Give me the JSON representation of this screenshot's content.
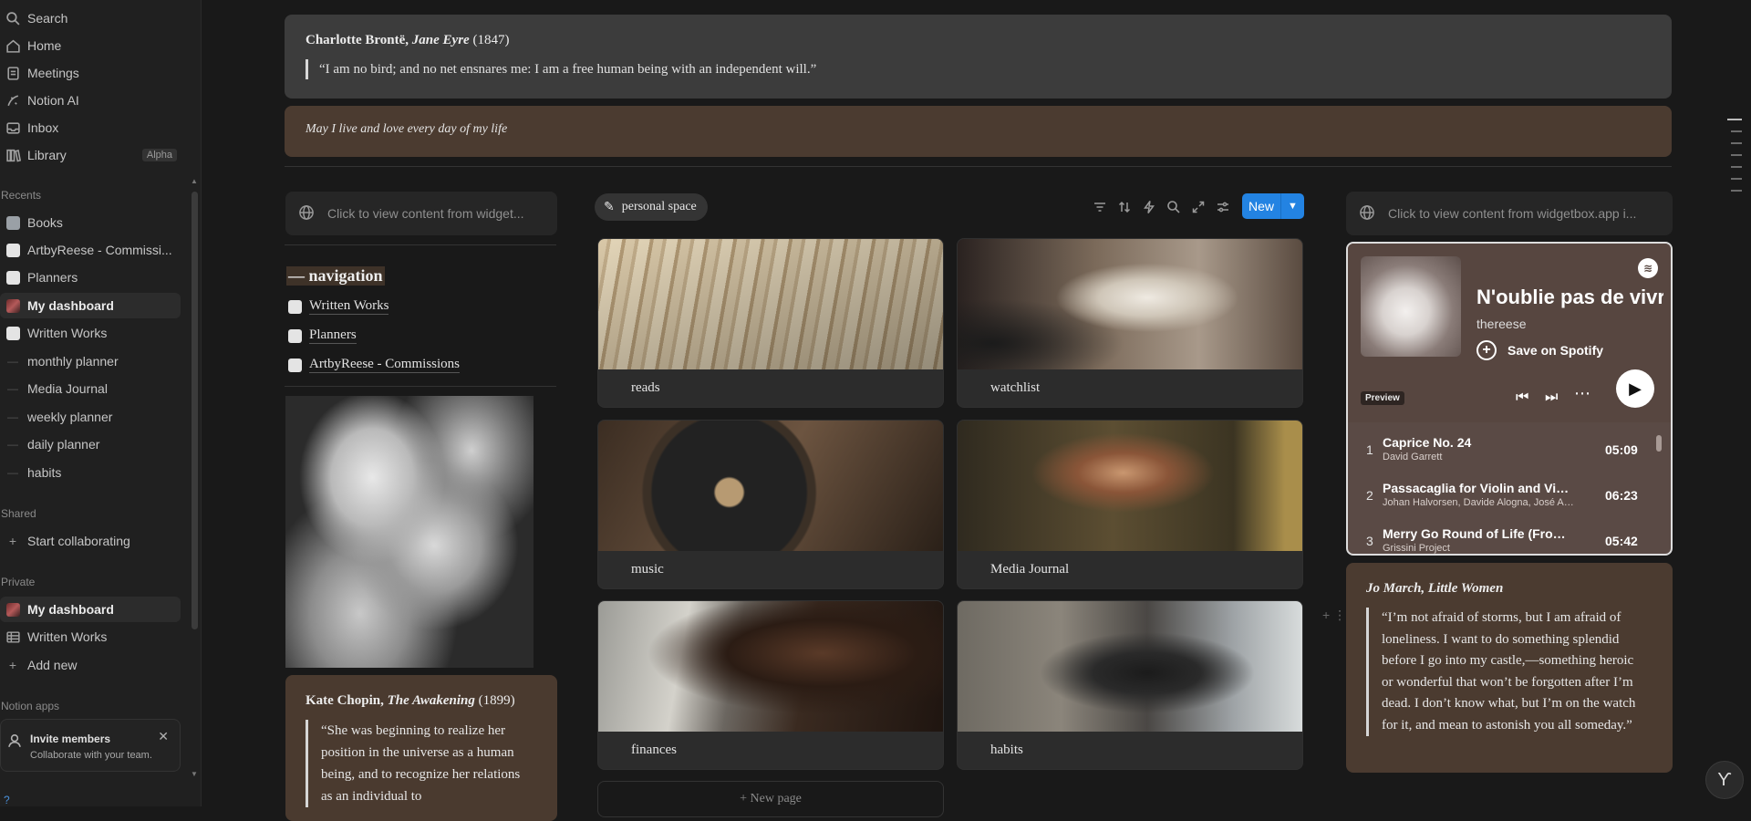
{
  "sidebar": {
    "top_items": [
      {
        "label": "Search",
        "icon": "search-icon"
      },
      {
        "label": "Home",
        "icon": "home-icon"
      },
      {
        "label": "Meetings",
        "icon": "meetings-icon"
      },
      {
        "label": "Notion AI",
        "icon": "notion-ai-icon"
      },
      {
        "label": "Inbox",
        "icon": "inbox-icon"
      },
      {
        "label": "Library",
        "icon": "library-icon",
        "badge": "Alpha"
      }
    ],
    "recents_label": "Recents",
    "recents": [
      {
        "label": "Books"
      },
      {
        "label": "ArtbyReese - Commissi..."
      },
      {
        "label": "Planners"
      },
      {
        "label": "My dashboard"
      },
      {
        "label": "Written Works"
      },
      {
        "label": "monthly planner"
      },
      {
        "label": "Media Journal"
      },
      {
        "label": "weekly planner"
      },
      {
        "label": "daily planner"
      },
      {
        "label": "habits"
      }
    ],
    "shared_label": "Shared",
    "start_collaborating": "Start collaborating",
    "private_label": "Private",
    "private": [
      {
        "label": "My dashboard"
      },
      {
        "label": "Written Works"
      }
    ],
    "add_new": "Add new",
    "notion_apps_label": "Notion apps",
    "invite": {
      "title": "Invite members",
      "subtitle": "Collaborate with your team."
    }
  },
  "quotes": {
    "bronte": {
      "author": "Charlotte Brontë, ",
      "work": "Jane Eyre",
      "year": " (1847)",
      "text": "“I am no bird; and no net ensnares me: I am a free human being with an independent will.”"
    },
    "motto": "May I live and love every day of my life",
    "chopin": {
      "author": "Kate Chopin, ",
      "work": "The Awakening",
      "year": " (1899)",
      "text": "“She was beginning to realize her position in the universe as a human being, and to recognize her relations as an individual to"
    },
    "jo": {
      "title": "Jo March, Little Women",
      "text": "“I’m not afraid of storms, but I am afraid of loneliness. I want to do something splendid before I go into my castle,—something heroic or wonderful that won’t be forgotten after I’m dead. I don’t know what, but I’m on the watch for it, and mean to astonish you all someday.”"
    }
  },
  "widgets": {
    "left": "Click to view content from widget...",
    "right": "Click to view content from widgetbox.app i..."
  },
  "navigation": {
    "heading": "— navigation",
    "links": [
      {
        "label": "Written Works"
      },
      {
        "label": "Planners"
      },
      {
        "label": "ArtbyReese - Commissions"
      }
    ]
  },
  "gallery": {
    "tag": "personal space",
    "new_label": "New",
    "cards": [
      {
        "label": "reads"
      },
      {
        "label": "watchlist"
      },
      {
        "label": "music"
      },
      {
        "label": "Media Journal"
      },
      {
        "label": "finances"
      },
      {
        "label": "habits"
      }
    ],
    "new_page": "+  New page"
  },
  "spotify": {
    "title": "N'oublie pas de vivre",
    "artist": "thereese",
    "save": "Save on Spotify",
    "preview": "Preview",
    "tracks": [
      {
        "num": "1",
        "title": "Caprice No. 24",
        "artist": "David Garrett",
        "duration": "05:09"
      },
      {
        "num": "2",
        "title": "Passacaglia for Violin and Viola",
        "artist": "Johan Halvorsen, Davide Alogna, José Adolfo Alejo",
        "duration": "06:23"
      },
      {
        "num": "3",
        "title": "Merry Go Round of Life (From Howl's Moving Castle)",
        "artist": "Grissini Project",
        "duration": "05:42"
      }
    ]
  }
}
